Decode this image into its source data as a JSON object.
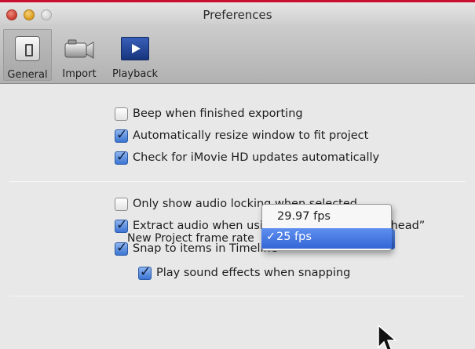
{
  "window": {
    "title": "Preferences",
    "accent_color": "#c8102e"
  },
  "toolbar": {
    "items": [
      {
        "label": "General",
        "icon": "general-switch-icon",
        "selected": true
      },
      {
        "label": "Import",
        "icon": "camcorder-icon",
        "selected": false
      },
      {
        "label": "Playback",
        "icon": "playback-screen-icon",
        "selected": false
      }
    ]
  },
  "sections": [
    {
      "options": [
        {
          "label": "Beep when finished exporting",
          "checked": false
        },
        {
          "label": "Automatically resize window to fit project",
          "checked": true
        },
        {
          "label": "Check for iMovie HD updates automatically",
          "checked": true
        }
      ]
    },
    {
      "options": [
        {
          "label": "Only show audio locking when selected",
          "checked": false
        },
        {
          "label": "Extract audio when using “Paste Over at Playhead”",
          "checked": true
        },
        {
          "label": "Snap to items in Timeline",
          "checked": true
        },
        {
          "label": "Play sound effects when snapping",
          "checked": true
        }
      ]
    }
  ],
  "frame_rate": {
    "label": "New Project frame rate",
    "options": [
      "29.97 fps",
      "25 fps"
    ],
    "selected": "25 fps",
    "check_mark": "✓",
    "highlight_color": "#3d6fdc"
  }
}
